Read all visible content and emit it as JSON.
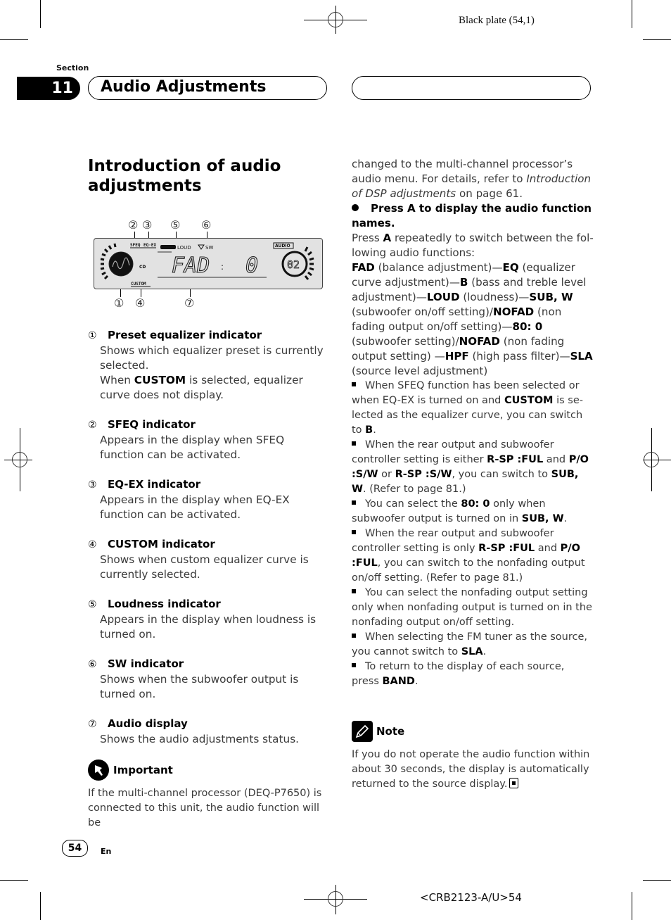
{
  "header": {
    "plate": "Black plate (54,1)",
    "section_label": "Section",
    "section_number": "11",
    "section_title": "Audio Adjustments"
  },
  "page_title": "Introduction of audio adjustments",
  "figure": {
    "callouts": [
      "②",
      "③",
      "⑤",
      "⑥",
      "①",
      "④",
      "⑦"
    ],
    "lcd": {
      "sfeq": "SFEQ",
      "eqex": "EQ·EX",
      "loud": "LOUD",
      "sw": "SW",
      "cd": "CD",
      "custom": "CUSTOM",
      "audio": "AUDIO",
      "main_text": "FAD",
      "colon": ":",
      "value": "0",
      "disc_number": "02"
    }
  },
  "items": [
    {
      "num": "①",
      "title": "Preset equalizer indicator",
      "body": [
        "Shows which equalizer preset is currently selected.",
        "When ",
        "CUSTOM",
        " is selected, equalizer curve does not display."
      ]
    },
    {
      "num": "②",
      "title": "SFEQ indicator",
      "body": "Appears in the display when SFEQ function can be activated."
    },
    {
      "num": "③",
      "title": "EQ-EX indicator",
      "body": "Appears in the display when EQ-EX function can be activated."
    },
    {
      "num": "④",
      "title": "CUSTOM indicator",
      "body": "Shows when custom equalizer curve is cur­rently selected."
    },
    {
      "num": "⑤",
      "title": "Loudness indicator",
      "body": "Appears in the display when loudness is turned on."
    },
    {
      "num": "⑥",
      "title": "SW indicator",
      "body": "Shows when the subwoofer output is turned on."
    },
    {
      "num": "⑦",
      "title": "Audio display",
      "body": "Shows the audio adjustments status."
    }
  ],
  "important": {
    "label": "Important",
    "text_left": "If the multi-channel processor (DEQ-P7650) is connected to this unit, the audio function will be",
    "text_right_1": "changed to the multi-channel processor’s audio menu. For details, refer to ",
    "link": "Introduction of DSP ad­justments",
    "text_right_2": " on page 61."
  },
  "step": {
    "heading": "Press A to display the audio function names.",
    "intro_1": "Press ",
    "intro_key": "A",
    "intro_2": " repeatedly to switch between the fol­lowing audio functions:",
    "functions": [
      {
        "key": "FAD",
        "desc": " (balance adjustment)—"
      },
      {
        "key": "EQ",
        "desc": " (equalizer curve adjustment)—"
      },
      {
        "key": "B",
        "desc": " (bass and treble level adjustment)—"
      },
      {
        "key": "LOUD",
        "desc": " (loudness)—"
      },
      {
        "key": "SUB, W",
        "desc": " (subwoofer on/off setting)/"
      },
      {
        "key": "NOFAD",
        "desc": " (non fading output on/off setting)—"
      },
      {
        "key": "80: 0",
        "desc": " (subwoofer set­ting)/"
      },
      {
        "key": "NOFAD",
        "desc": " (non fading output setting) —"
      },
      {
        "key": "HPF",
        "desc": " (high pass filter)—"
      },
      {
        "key": "SLA",
        "desc": " (source level ad­justment)"
      }
    ]
  },
  "bullets": [
    [
      {
        "t": "When SFEQ function has been selected or when EQ-EX is turned on and "
      },
      {
        "b": "CUSTOM"
      },
      {
        "t": " is se­lected as the equalizer curve, you can switch to "
      },
      {
        "b": "B"
      },
      {
        "t": "."
      }
    ],
    [
      {
        "t": "When the rear output and subwoofer control­ler setting is either "
      },
      {
        "b": "R-SP :FUL"
      },
      {
        "t": " and "
      },
      {
        "b": "P/O  :S/W"
      },
      {
        "t": " or "
      },
      {
        "b": "R-SP :S/W"
      },
      {
        "t": ", you can switch to "
      },
      {
        "b": "SUB, W"
      },
      {
        "t": ". (Refer to page 81.)"
      }
    ],
    [
      {
        "t": "You can select the "
      },
      {
        "b": "80: 0"
      },
      {
        "t": " only when subwoofer output is turned on in "
      },
      {
        "b": "SUB, W"
      },
      {
        "t": "."
      }
    ],
    [
      {
        "t": "When the rear output and subwoofer control­ler setting is only "
      },
      {
        "b": "R-SP :FUL"
      },
      {
        "t": " and "
      },
      {
        "b": "P/O  :FUL"
      },
      {
        "t": ", you can switch to the nonfading output on/off setting. (Refer to page 81.)"
      }
    ],
    [
      {
        "t": "You can select the nonfading output setting only when nonfading output is turned on in the nonfading output on/off setting."
      }
    ],
    [
      {
        "t": "When selecting the FM tuner as the source, you cannot switch to "
      },
      {
        "b": "SLA"
      },
      {
        "t": "."
      }
    ],
    [
      {
        "t": "To return to the display of each source, press "
      },
      {
        "b": "BAND"
      },
      {
        "t": "."
      }
    ]
  ],
  "note": {
    "label": "Note",
    "text": "If you do not operate the audio function within about 30 seconds, the display is automatically re­turned to the source display."
  },
  "footer": {
    "page_number": "54",
    "language": "En",
    "code": "<CRB2123-A/U>54"
  },
  "icons": {
    "important": "pushpin-icon",
    "note": "pencil-icon",
    "end": "end-mark-icon",
    "step": "bullet-dot-icon"
  }
}
